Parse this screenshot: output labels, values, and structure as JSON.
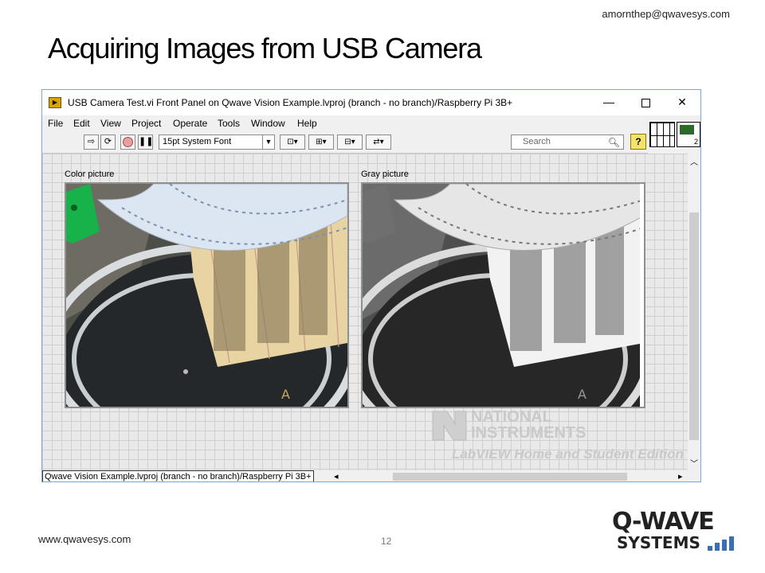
{
  "slide": {
    "email": "amornthep@qwavesys.com",
    "title": "Acquiring Images from USB Camera",
    "website": "www.qwavesys.com",
    "page_number": "12"
  },
  "window": {
    "title": "USB Camera Test.vi Front Panel on Qwave Vision Example.lvproj (branch - no branch)/Raspberry Pi 3B+",
    "controls": {
      "minimize": "—",
      "close": "✕"
    },
    "menu": [
      "File",
      "Edit",
      "View",
      "Project",
      "Operate",
      "Tools",
      "Window",
      "Help"
    ],
    "toolbar": {
      "font": "15pt System Font",
      "search_placeholder": "Search",
      "help": "?"
    },
    "vi_icon_number": "2",
    "panel": {
      "color_label": "Color picture",
      "gray_label": "Gray picture"
    },
    "watermark": {
      "line1": "NATIONAL",
      "line2": "INSTRUMENTS",
      "line3": "LabVIEW Home and Student Edition"
    },
    "status_path": "Qwave Vision Example.lvproj (branch - no branch)/Raspberry Pi 3B+"
  },
  "logo": {
    "line1": "Q-WAVE",
    "line2": "SYSTEMS"
  },
  "colors": {
    "window_border": "#7aa7d6",
    "breadboard": "#e8d4a2",
    "clip_green": "#18b24b"
  }
}
